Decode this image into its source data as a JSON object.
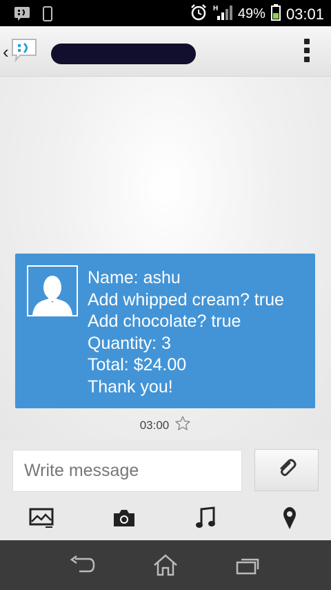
{
  "status_bar": {
    "network_indicator": "H",
    "battery_percent": "49%",
    "time": "03:01",
    "icons": [
      "bbm-notification-icon",
      "phone-icon",
      "alarm-icon",
      "signal-icon",
      "battery-icon"
    ]
  },
  "action_bar": {
    "back_icon": "chevron-left-icon",
    "app_logo": "messaging-app-icon",
    "contact_name": "[redacted]",
    "menu_icon": "overflow-menu-icon"
  },
  "message": {
    "lines": [
      "Name: ashu",
      "Add whipped cream? true",
      "Add chocolate? true",
      "Quantity: 3",
      "Total: $24.00",
      "Thank you!"
    ],
    "time": "03:00",
    "bubble_color": "#4394d6",
    "star_icon": "star-outline-icon",
    "avatar_icon": "default-contact-avatar-icon"
  },
  "compose": {
    "placeholder": "Write message",
    "value": "",
    "attach_icon": "paperclip-icon"
  },
  "media_buttons": [
    {
      "name": "gallery-icon"
    },
    {
      "name": "camera-icon"
    },
    {
      "name": "music-icon"
    },
    {
      "name": "location-pin-icon"
    }
  ],
  "nav_bar": {
    "buttons": [
      "back-icon",
      "home-icon",
      "recent-apps-icon"
    ]
  }
}
